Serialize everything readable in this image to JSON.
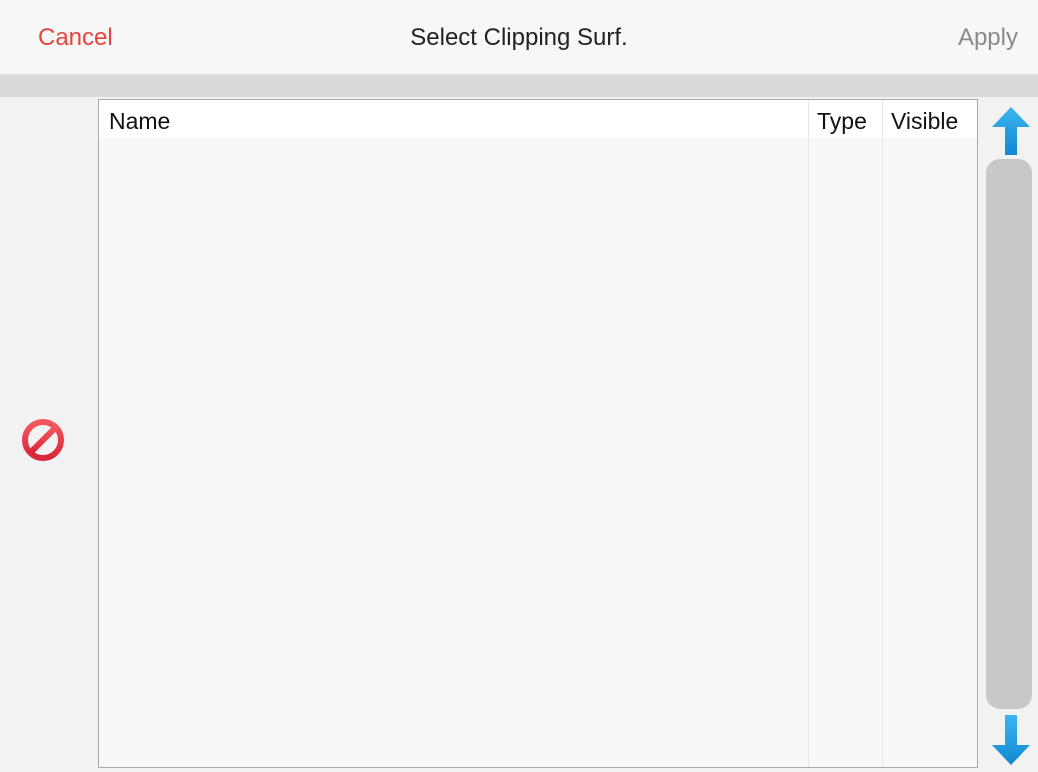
{
  "header": {
    "cancel_label": "Cancel",
    "title": "Select Clipping Surf.",
    "apply_label": "Apply"
  },
  "table": {
    "columns": [
      "Name",
      "Type",
      "Visible"
    ],
    "rows": []
  },
  "colors": {
    "cancel": "#e8443a",
    "apply_disabled": "#8a8a8a",
    "arrow": "#1e9be0",
    "clear_icon": "#e23c4c"
  },
  "icons": {
    "clear": "no-entry-icon",
    "scroll_up": "arrow-up-icon",
    "scroll_down": "arrow-down-icon"
  }
}
